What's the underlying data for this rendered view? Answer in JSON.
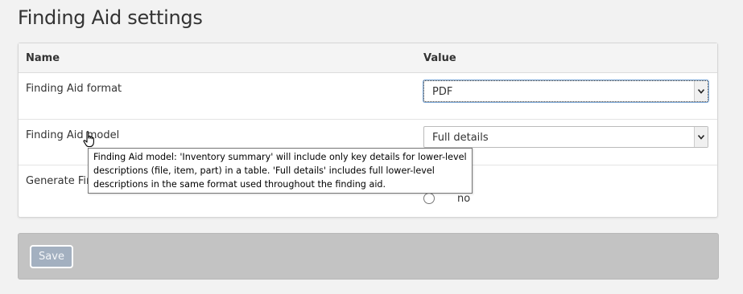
{
  "page": {
    "title": "Finding Aid settings"
  },
  "table": {
    "header": {
      "name": "Name",
      "value": "Value"
    },
    "rows": [
      {
        "label": "Finding Aid format",
        "value": "PDF"
      },
      {
        "label": "Finding Aid model",
        "value": "Full details"
      },
      {
        "label": "Generate Fin",
        "radio_option": "no"
      }
    ]
  },
  "tooltip": {
    "text": "Finding Aid model: 'Inventory summary' will include only key details for lower-level descriptions (file, item, part) in a table. 'Full details' includes full lower-level descriptions in the same format used throughout the finding aid."
  },
  "actions": {
    "save_label": "Save"
  },
  "icons": {
    "select_arrow": "chevron-down-icon",
    "cursor": "hand-pointer-icon"
  },
  "colors": {
    "save_button": "#a3b0c0",
    "actions_bar": "#c3c3c3",
    "focus_ring": "#7aa7d8"
  }
}
